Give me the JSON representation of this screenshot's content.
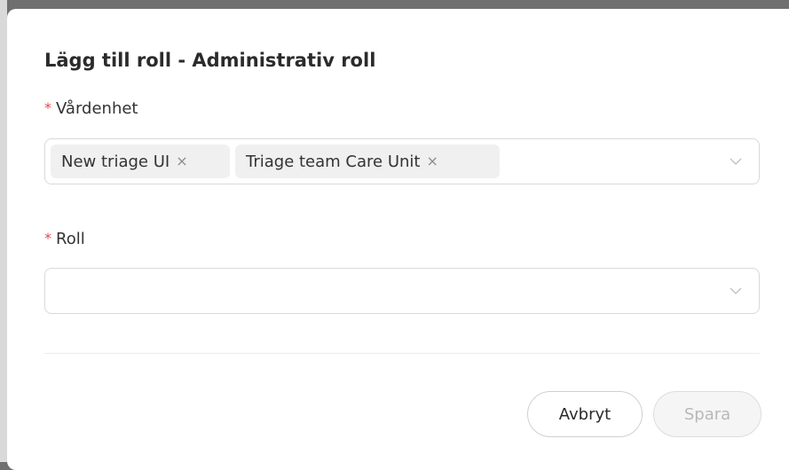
{
  "dialog": {
    "title": "Lägg till roll - Administrativ roll",
    "fields": {
      "unit": {
        "required_mark": "*",
        "label": "Vårdenhet",
        "selected_tags": [
          {
            "label": "New triage UI",
            "remove_glyph": "×"
          },
          {
            "label": "Triage team Care Unit",
            "remove_glyph": "×"
          }
        ],
        "dropdown_icon": "chevron-down-icon"
      },
      "role": {
        "required_mark": "*",
        "label": "Roll",
        "value": "",
        "dropdown_icon": "chevron-down-icon"
      }
    },
    "buttons": {
      "cancel": "Avbryt",
      "save": "Spara"
    },
    "colors": {
      "required": "#e5484d",
      "save_disabled_text": "#b8b8b8",
      "tag_background": "#f0f0f0"
    }
  }
}
